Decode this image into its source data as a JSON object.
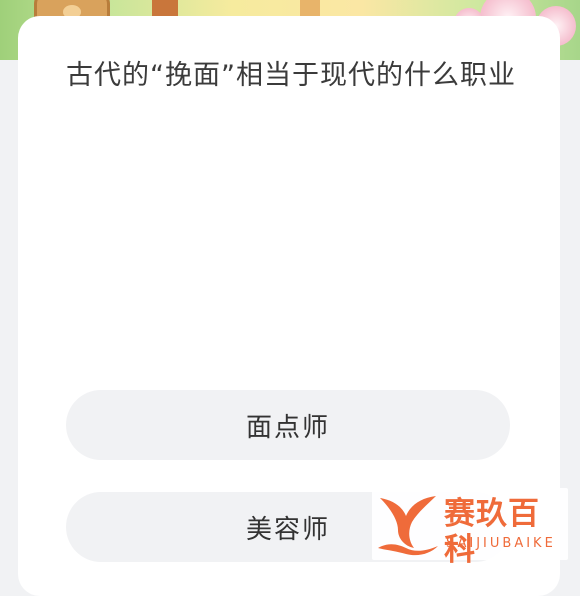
{
  "banner": {
    "decorations": [
      "barrel-illustration",
      "wooden-post-illustration",
      "cherry-blossom-illustration"
    ]
  },
  "quiz": {
    "question": "古代的“挽面”相当于现代的什么职业",
    "options": [
      {
        "label": "面点师"
      },
      {
        "label": "美容师"
      }
    ]
  },
  "watermark": {
    "logo_icon": "orange-fish-tail-logo",
    "name_cn": "赛玖百科",
    "name_en": "SAIJIUBAIKE",
    "color": "#ef6b3a"
  },
  "colors": {
    "background": "#f1f2f4",
    "card": "#ffffff",
    "option_fill": "#f1f2f4",
    "text": "#333333"
  }
}
